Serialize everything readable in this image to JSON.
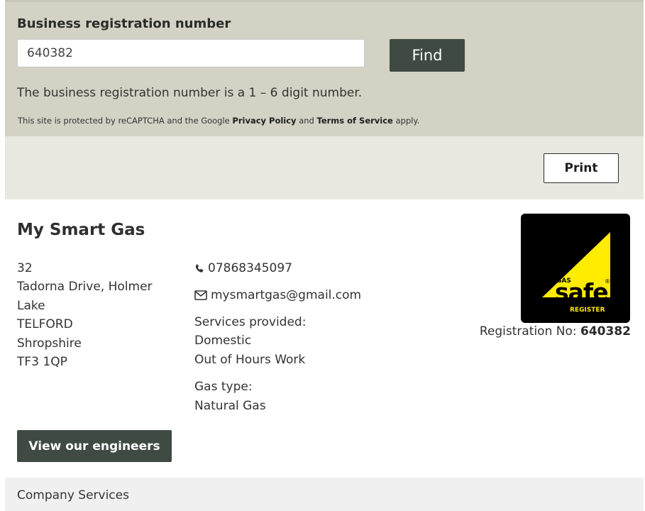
{
  "search": {
    "label": "Business registration number",
    "input_value": "640382",
    "find_label": "Find",
    "help_text": "The business registration number is a 1 – 6 digit number.",
    "recaptcha": {
      "prefix": "This site is protected by reCAPTCHA and the Google ",
      "privacy_link": "Privacy Policy",
      "and": " and ",
      "terms_link": "Terms of Service",
      "suffix": " apply."
    }
  },
  "toolbar": {
    "print_label": "Print"
  },
  "business": {
    "name": "My Smart Gas",
    "address_lines": [
      "32",
      "Tadorna Drive, Holmer Lake",
      "TELFORD",
      "Shropshire",
      "TF3 1QP"
    ],
    "phone": "07868345097",
    "email": "mysmartgas@gmail.com",
    "services_heading": "Services provided:",
    "services": [
      "Domestic",
      "Out of Hours Work"
    ],
    "gas_type_heading": "Gas type:",
    "gas_type": "Natural Gas",
    "logo": {
      "top_word": "GAS",
      "main_word": "safe",
      "sub_word": "REGISTER",
      "reg_mark": "®"
    },
    "registration_label": "Registration No: ",
    "registration_number": "640382",
    "view_engineers_label": "View our engineers"
  },
  "company_services": {
    "title": "Company Services"
  },
  "colors": {
    "accent_dark_green": "#3f4b42",
    "search_panel_bg": "#d4d2c4",
    "page_bg": "#e8e8e0",
    "logo_yellow": "#ffec00"
  },
  "icons": {
    "phone": "phone-icon",
    "email": "envelope-icon"
  }
}
